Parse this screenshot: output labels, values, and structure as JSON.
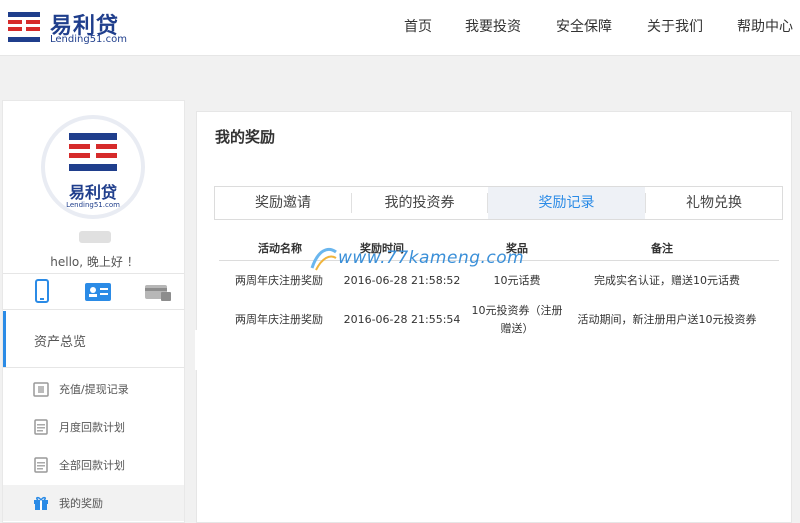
{
  "logo": {
    "text_cn": "易利贷",
    "text_en": "Lending51.com"
  },
  "nav": [
    "首页",
    "我要投资",
    "安全保障",
    "关于我们",
    "帮助中心"
  ],
  "sidebar": {
    "avatar_cn": "易利贷",
    "avatar_en": "Lending51.com",
    "greeting": "hello, 晚上好 ！",
    "overview_label": "资产总览",
    "menu": [
      {
        "label": "充值/提现记录",
        "icon": "record-icon"
      },
      {
        "label": "月度回款计划",
        "icon": "doc-icon"
      },
      {
        "label": "全部回款计划",
        "icon": "doc-icon"
      },
      {
        "label": "我的奖励",
        "icon": "gift-icon"
      }
    ]
  },
  "panel": {
    "title": "我的奖励",
    "tabs": [
      "奖励邀请",
      "我的投资券",
      "奖励记录",
      "礼物兑换"
    ],
    "active_tab": "奖励记录",
    "table": {
      "headers": [
        "活动名称",
        "奖励时间",
        "奖品",
        "备注"
      ],
      "rows": [
        [
          "两周年庆注册奖励",
          "2016-06-28 21:58:52",
          "10元话费",
          "完成实名认证，赠送10元话费"
        ],
        [
          "两周年庆注册奖励",
          "2016-06-28 21:55:54",
          "10元投资券（注册赠送）",
          "活动期间，新注册用户送10元投资券"
        ]
      ]
    }
  },
  "watermark": "www.77kameng.com",
  "colors": {
    "brand": "#1f3e8c",
    "accent": "#2b8be6",
    "logo_red": "#d62b2b"
  }
}
